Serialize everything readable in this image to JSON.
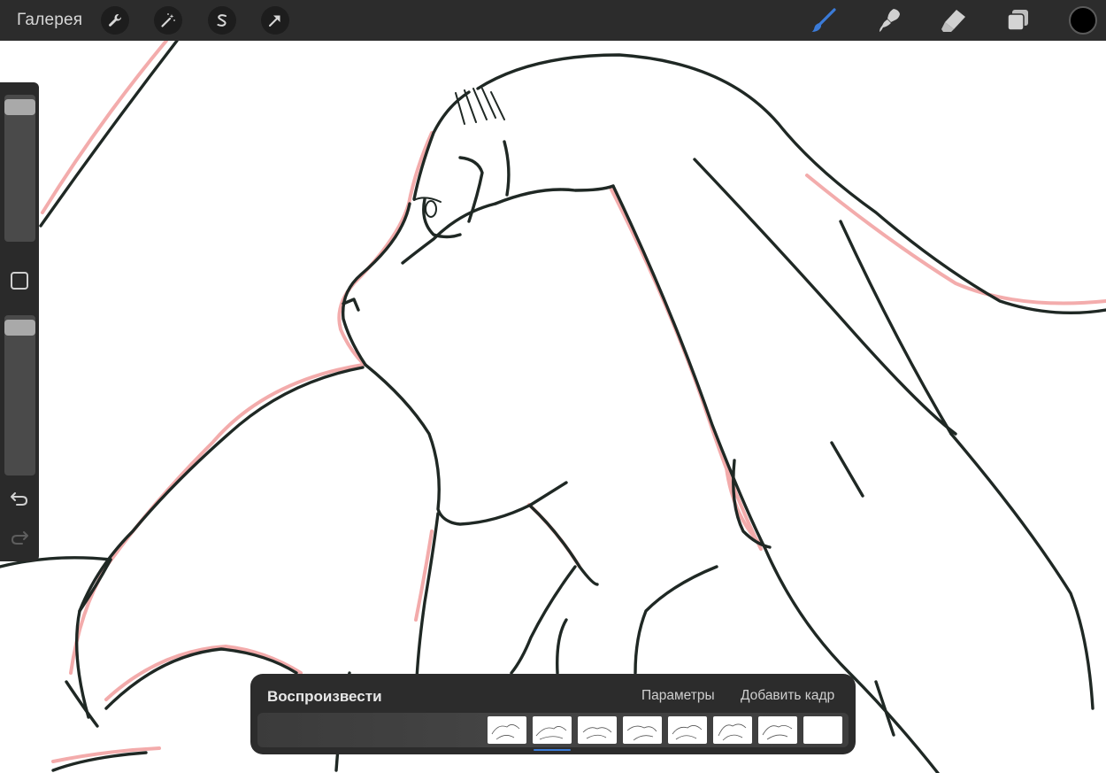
{
  "topbar": {
    "gallery_label": "Галерея",
    "left_tools": [
      "wrench-icon",
      "magic-wand-icon",
      "selection-icon",
      "transform-arrow-icon"
    ],
    "right_tools": [
      "brush-icon",
      "smudge-icon",
      "eraser-icon",
      "layers-icon"
    ],
    "active_tool": "brush-icon",
    "accent_color": "#3b7bd8",
    "current_color": "#000000"
  },
  "sidebar": {
    "brush_size_level": 0.97,
    "opacity_level": 0.97,
    "controls": [
      "brush-size-slider",
      "modify-square-icon",
      "opacity-slider",
      "undo-icon",
      "redo-icon"
    ]
  },
  "animation": {
    "play_label": "Воспроизвести",
    "settings_label": "Параметры",
    "add_frame_label": "Добавить кадр",
    "frame_count": 8,
    "selected_frame": 2,
    "indicator_color": "#3b7bd8"
  },
  "canvas": {
    "line_color": "#1e2a26",
    "onion_skin_color": "#f0a0a0"
  }
}
